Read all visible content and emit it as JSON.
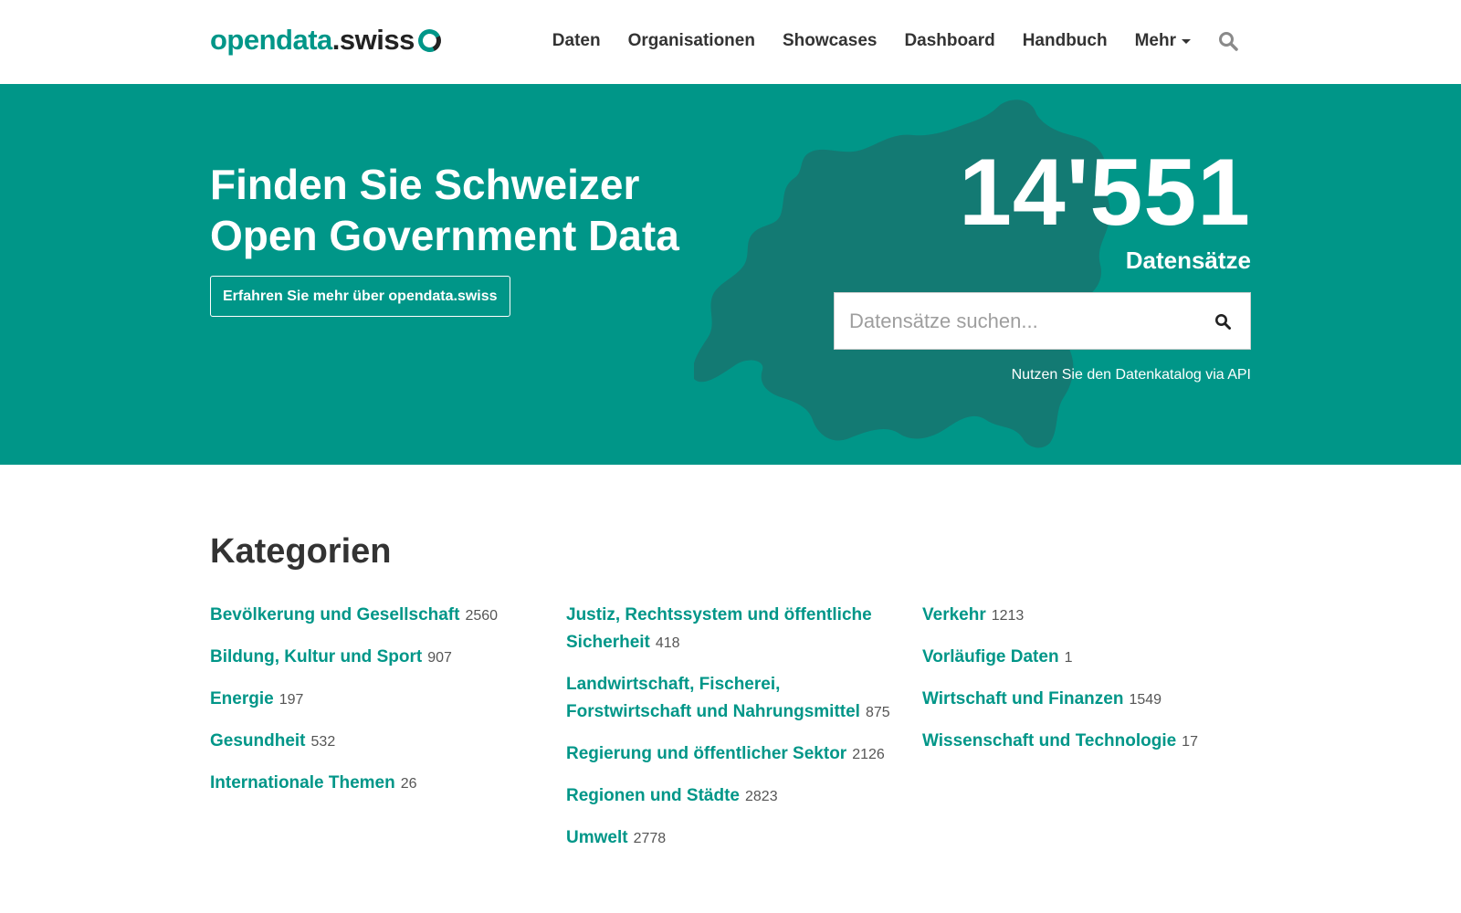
{
  "header": {
    "logo": {
      "part1": "opendata",
      "part2": ".swiss"
    },
    "nav": [
      {
        "label": "Daten"
      },
      {
        "label": "Organisationen"
      },
      {
        "label": "Showcases"
      },
      {
        "label": "Dashboard"
      },
      {
        "label": "Handbuch"
      },
      {
        "label": "Mehr"
      }
    ],
    "search_icon": "search-icon"
  },
  "hero": {
    "title_line1": "Finden Sie Schweizer",
    "title_line2": "Open Government Data",
    "about_button": "Erfahren Sie mehr über opendata.swiss",
    "dataset_count": "14'551",
    "dataset_label": "Datensätze",
    "search_placeholder": "Datensätze suchen...",
    "api_link": "Nutzen Sie den Datenkatalog via API"
  },
  "colors": {
    "brand": "#009688",
    "map": "#137a73",
    "text": "#333333"
  },
  "categories": {
    "title": "Kategorien",
    "col1": [
      {
        "name": "Bevölkerung und Gesellschaft",
        "count": "2560"
      },
      {
        "name": "Bildung, Kultur und Sport",
        "count": "907"
      },
      {
        "name": "Energie",
        "count": "197"
      },
      {
        "name": "Gesundheit",
        "count": "532"
      },
      {
        "name": "Internationale Themen",
        "count": "26"
      }
    ],
    "col2": [
      {
        "name": "Justiz, Rechtssystem und öffentliche Sicherheit",
        "count": "418"
      },
      {
        "name": "Landwirtschaft, Fischerei, Forstwirtschaft und Nahrungsmittel",
        "count": "875"
      },
      {
        "name": "Regierung und öffentlicher Sektor",
        "count": "2126"
      },
      {
        "name": "Regionen und Städte",
        "count": "2823"
      },
      {
        "name": "Umwelt",
        "count": "2778"
      }
    ],
    "col3": [
      {
        "name": "Verkehr",
        "count": "1213"
      },
      {
        "name": "Vorläufige Daten",
        "count": "1"
      },
      {
        "name": "Wirtschaft und Finanzen",
        "count": "1549"
      },
      {
        "name": "Wissenschaft und Technologie",
        "count": "17"
      }
    ]
  }
}
